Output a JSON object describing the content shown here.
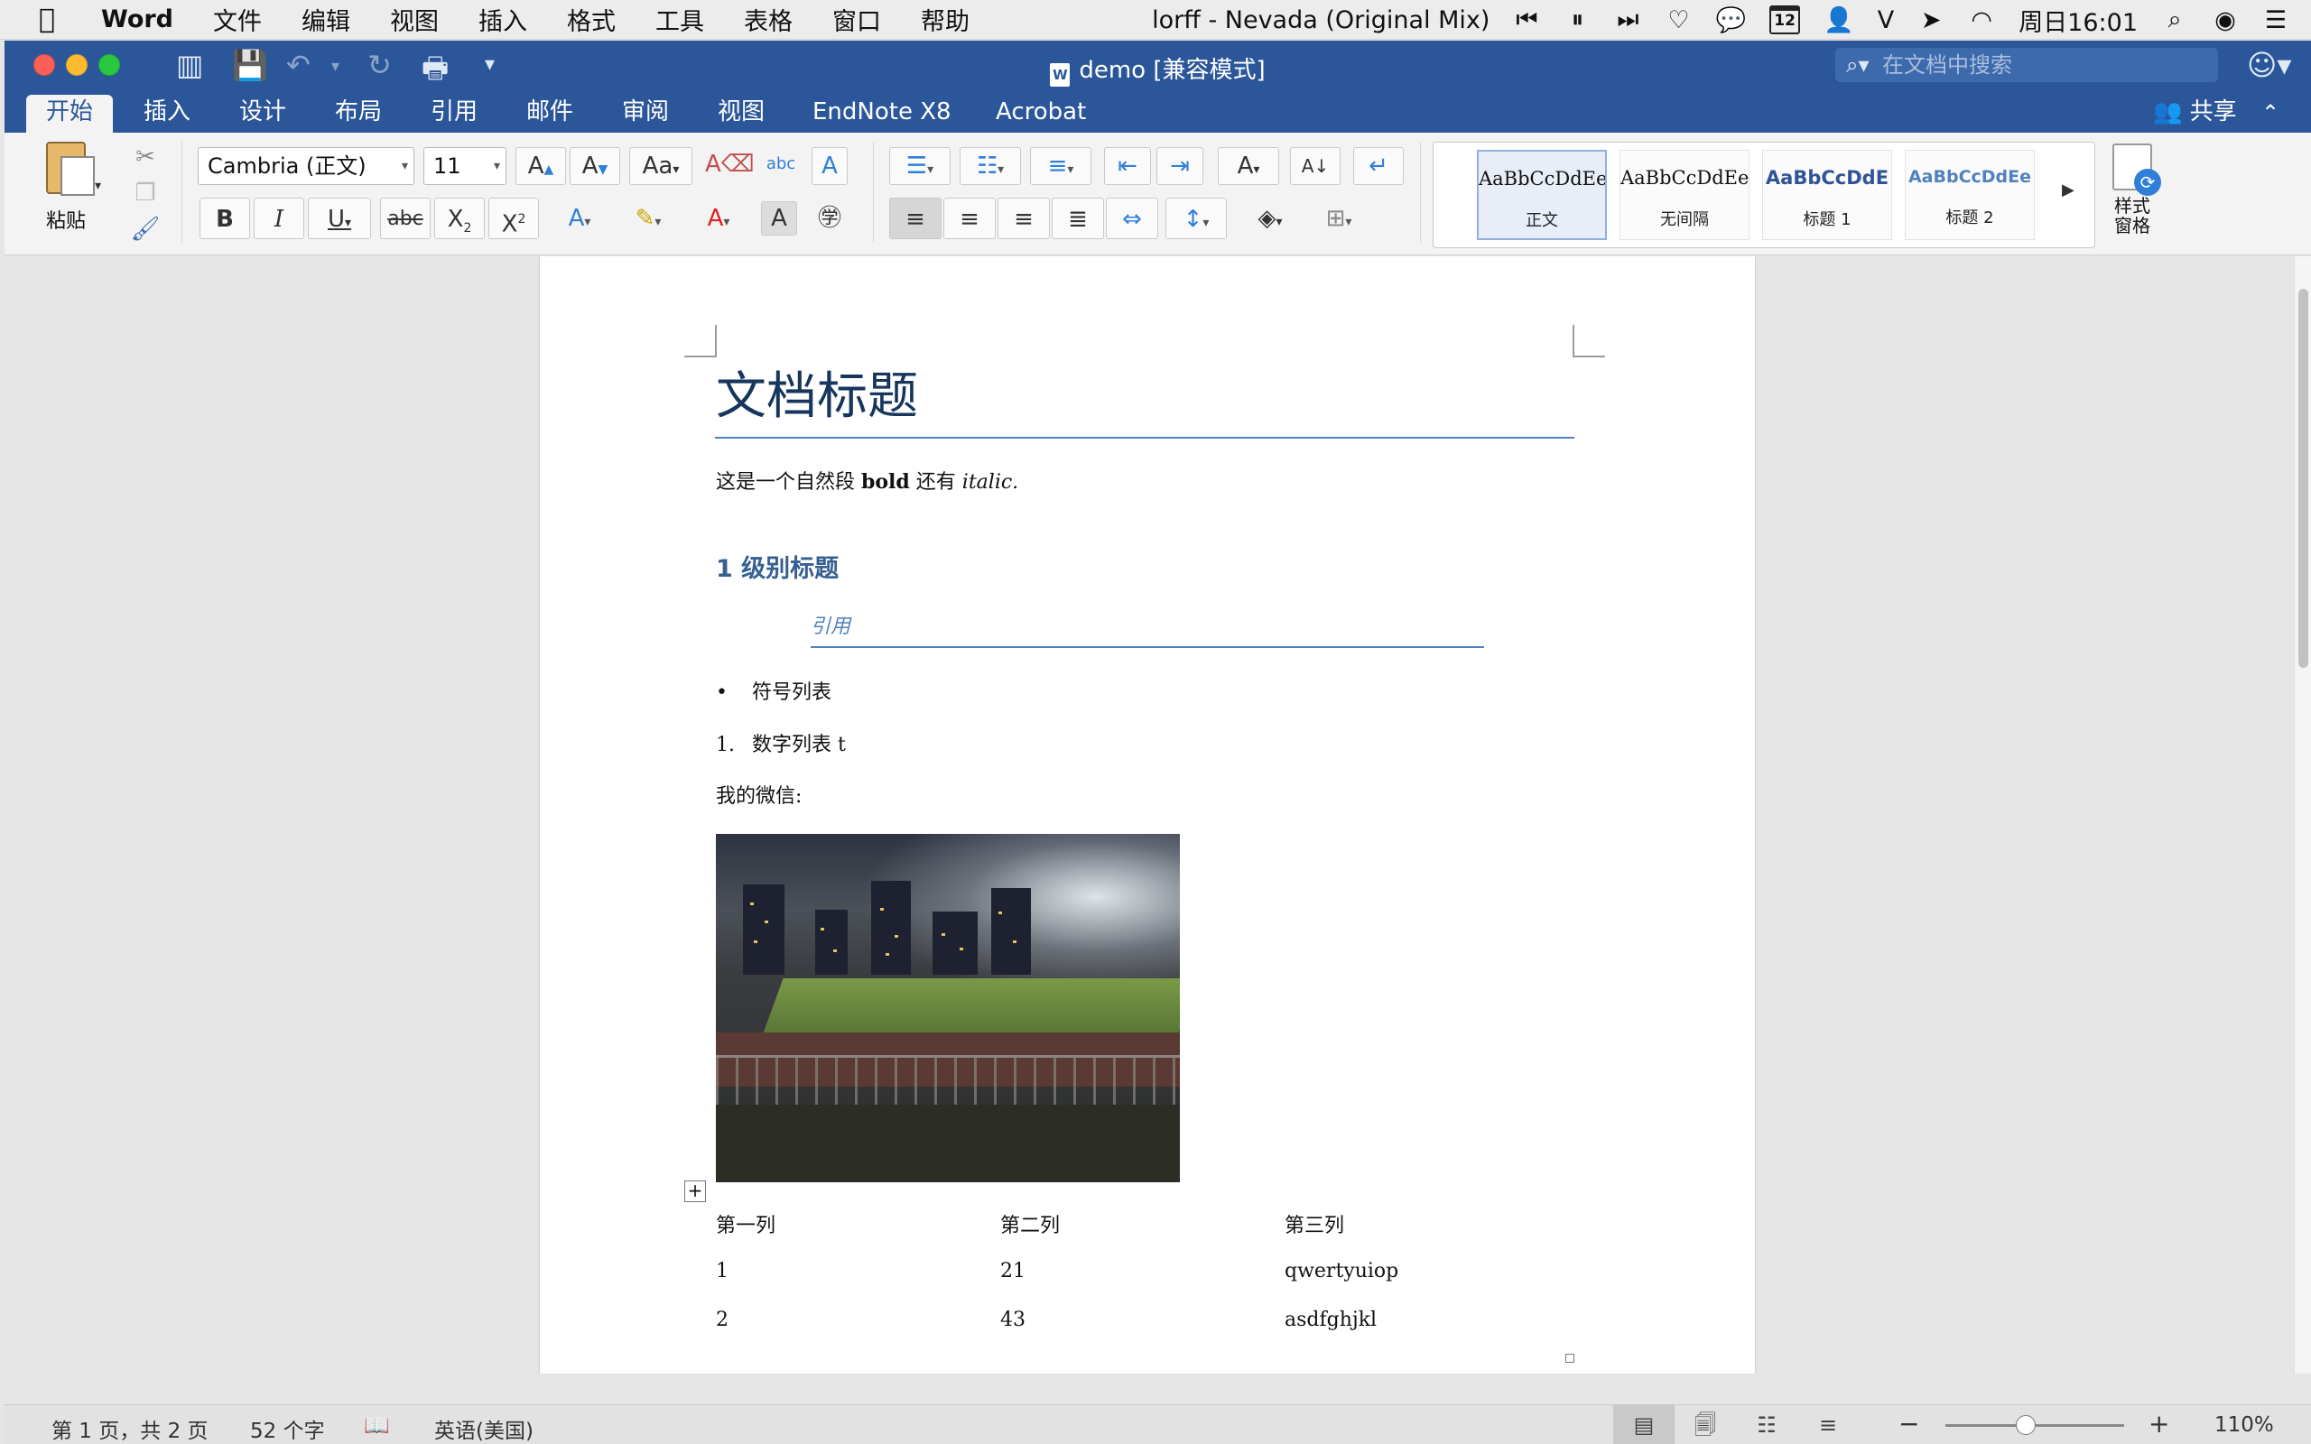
{
  "menubar": {
    "app_name": "Word",
    "items": [
      "文件",
      "编辑",
      "视图",
      "插入",
      "格式",
      "工具",
      "表格",
      "窗口",
      "帮助"
    ],
    "now_playing": "lorff - Nevada (Original Mix)",
    "calendar_day": "12",
    "input_method": "V",
    "clock": "周日16:01"
  },
  "window": {
    "title": "demo [兼容模式]",
    "search_placeholder": "在文档中搜索"
  },
  "tabs": [
    "开始",
    "插入",
    "设计",
    "布局",
    "引用",
    "邮件",
    "审阅",
    "视图",
    "EndNote X8",
    "Acrobat"
  ],
  "active_tab": "开始",
  "share_label": "共享",
  "ribbon": {
    "paste_label": "粘贴",
    "font_name": "Cambria (正文)",
    "font_size": "11",
    "styles": [
      {
        "preview": "AaBbCcDdEe",
        "name": "正文",
        "color": "#111111"
      },
      {
        "preview": "AaBbCcDdEe",
        "name": "无间隔",
        "color": "#111111"
      },
      {
        "preview": "AaBbCcDdE",
        "name": "标题 1",
        "color": "#2f5496"
      },
      {
        "preview": "AaBbCcDdEe",
        "name": "标题 2",
        "color": "#4f81bd"
      }
    ],
    "style_pane_label_1": "样式",
    "style_pane_label_2": "窗格"
  },
  "document": {
    "title": "文档标题",
    "para_prefix": "这是一个自然段 ",
    "para_bold": "bold",
    "para_mid": " 还有 ",
    "para_italic": "italic.",
    "heading1": "1 级别标题",
    "quote": "引用",
    "bullet_marker": "•",
    "bullet_item": "符号列表",
    "number_marker": "1.",
    "numbered_item": "数字列表 t",
    "wechat_label": "我的微信:",
    "image_description": "night football field photo",
    "table": {
      "headers": [
        "第一列",
        "第二列",
        "第三列"
      ],
      "rows": [
        [
          "1",
          "21",
          "qwertyuiop"
        ],
        [
          "2",
          "43",
          "asdfghjkl"
        ]
      ]
    }
  },
  "status": {
    "page": "第 1 页，共 2 页",
    "words": "52 个字",
    "language": "英语(美国)",
    "zoom": "110%",
    "zoom_fraction": 0.45
  },
  "colors": {
    "ribbon_blue": "#2b579a",
    "heading_blue": "#366092",
    "quote_blue": "#4f81bd"
  }
}
